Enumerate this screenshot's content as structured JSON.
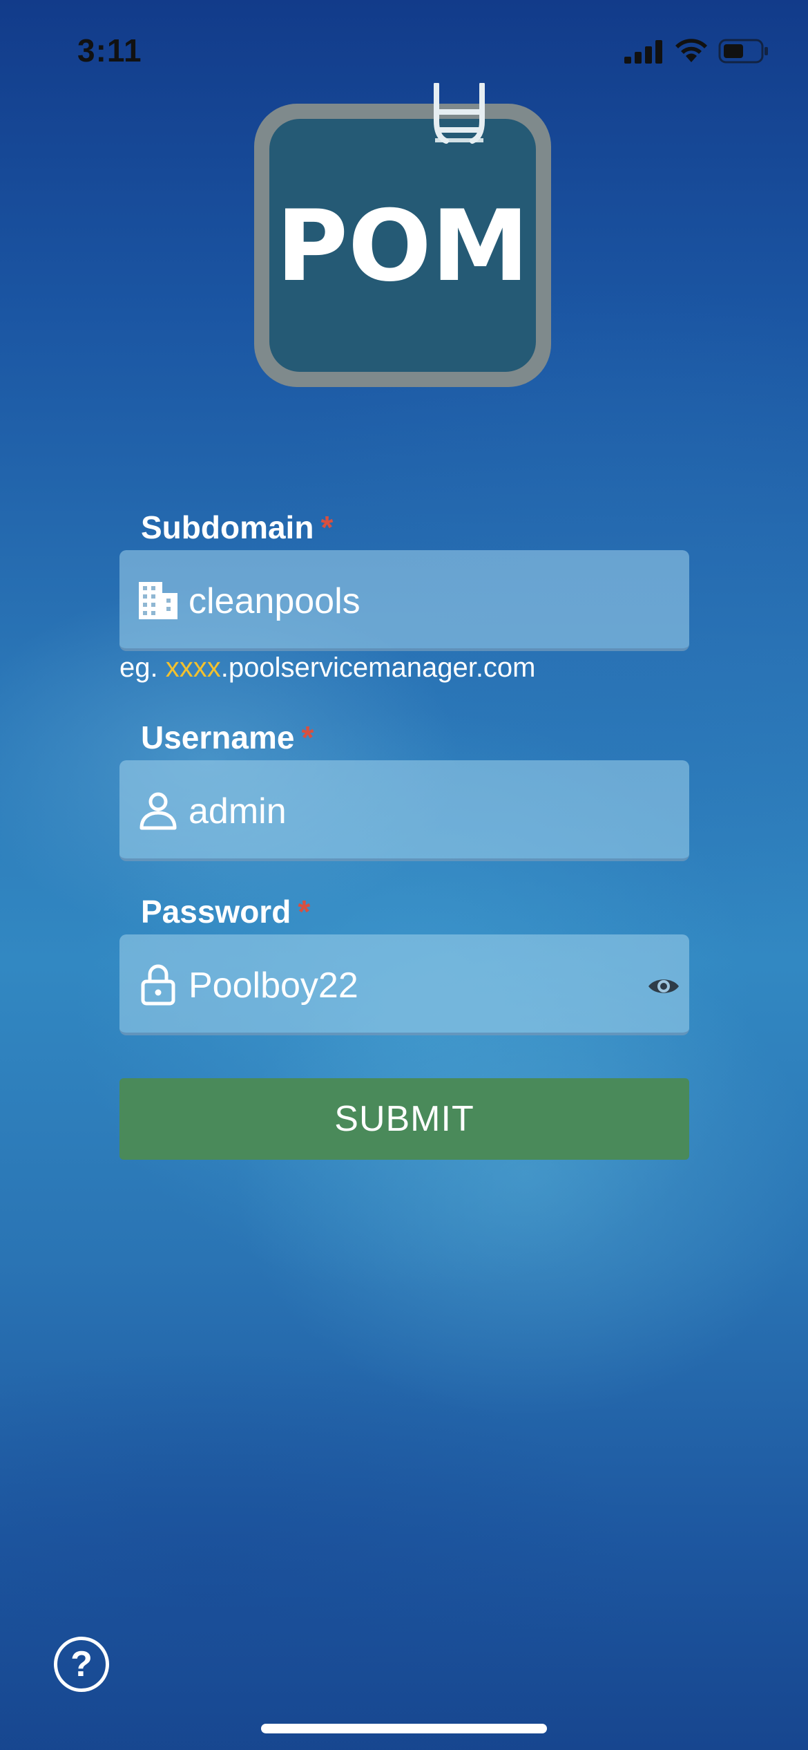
{
  "status_bar": {
    "time": "3:11",
    "icons": [
      "signal-icon",
      "wifi-icon",
      "battery-icon"
    ]
  },
  "logo": {
    "text": "POM",
    "icon": "pool-ladder-icon"
  },
  "form": {
    "subdomain": {
      "label": "Subdomain",
      "required_mark": "*",
      "icon": "building-icon",
      "value": "cleanpools",
      "hint_prefix": "eg. ",
      "hint_highlight": "xxxx",
      "hint_suffix": ".poolservicemanager.com"
    },
    "username": {
      "label": "Username",
      "required_mark": "*",
      "icon": "person-icon",
      "value": "admin"
    },
    "password": {
      "label": "Password",
      "required_mark": "*",
      "icon": "lock-icon",
      "value": "Poolboy22",
      "toggle_icon": "eye-icon"
    },
    "submit_label": "SUBMIT"
  },
  "help": {
    "label": "?",
    "icon": "question-circle-icon"
  },
  "colors": {
    "background_blue": "#2a75b6",
    "submit_green": "#4a8a5a",
    "required_red": "#d9503f",
    "hint_highlight": "#f2c12e",
    "logo_tile": "#255a75",
    "logo_frame": "#7f8a8c"
  }
}
